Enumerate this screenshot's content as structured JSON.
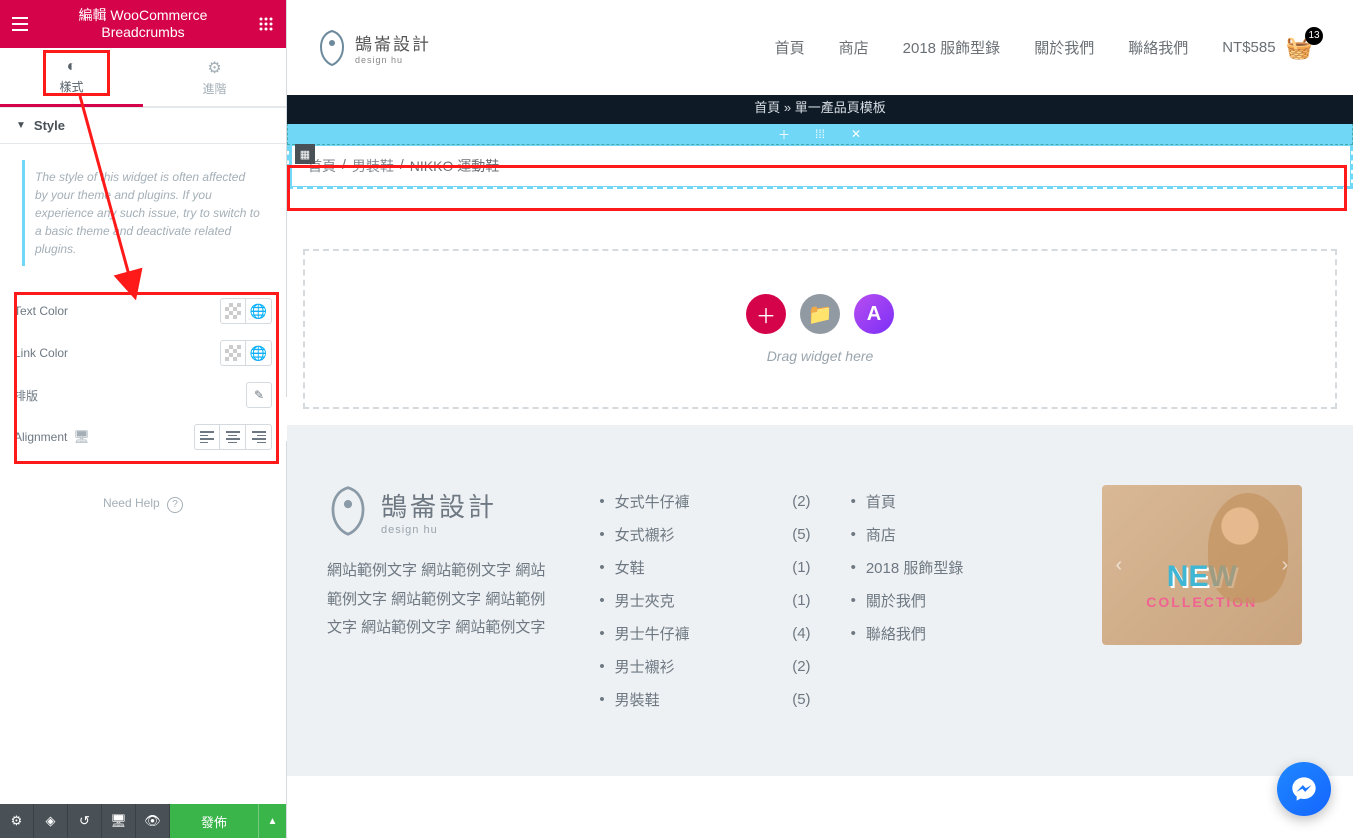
{
  "panel": {
    "title_l1": "編輯 WooCommerce",
    "title_l2": "Breadcrumbs",
    "tabs": {
      "style": "樣式",
      "advanced": "進階"
    },
    "section": "Style",
    "note": "The style of this widget is often affected by your theme and plugins. If you experience any such issue, try to switch to a basic theme and deactivate related plugins.",
    "controls": {
      "text_color": "Text Color",
      "link_color": "Link Color",
      "typography": "排版",
      "alignment": "Alignment"
    },
    "help": "Need Help",
    "publish": "發佈"
  },
  "site": {
    "brand_zh": "鵠崙設計",
    "brand_en": "design hu",
    "nav": [
      "首頁",
      "商店",
      "2018 服飾型錄",
      "關於我們",
      "聯絡我們"
    ],
    "cart_amount": "NT$585",
    "cart_count": "13"
  },
  "hero_breadcrumb": "首頁 » 單一產品頁模板",
  "breadcrumb": {
    "home": "首頁",
    "cat": "男裝鞋",
    "product": "NIKKO 運動鞋",
    "sep": " / "
  },
  "drop_hint": "Drag widget here",
  "footer": {
    "brand_zh": "鵠崙設計",
    "brand_en": "design hu",
    "desc": "網站範例文字 網站範例文字 網站範例文字 網站範例文字 網站範例文字 網站範例文字 網站範例文字",
    "cats": [
      {
        "name": "女式牛仔褲",
        "count": "(2)"
      },
      {
        "name": "女式襯衫",
        "count": "(5)"
      },
      {
        "name": "女鞋",
        "count": "(1)"
      },
      {
        "name": "男士夾克",
        "count": "(1)"
      },
      {
        "name": "男士牛仔褲",
        "count": "(4)"
      },
      {
        "name": "男士襯衫",
        "count": "(2)"
      },
      {
        "name": "男裝鞋",
        "count": "(5)"
      }
    ],
    "pages": [
      "首頁",
      "商店",
      "2018 服飾型錄",
      "關於我們",
      "聯絡我們"
    ],
    "banner_big": "NEW",
    "banner_sub": "COLLECTION"
  }
}
